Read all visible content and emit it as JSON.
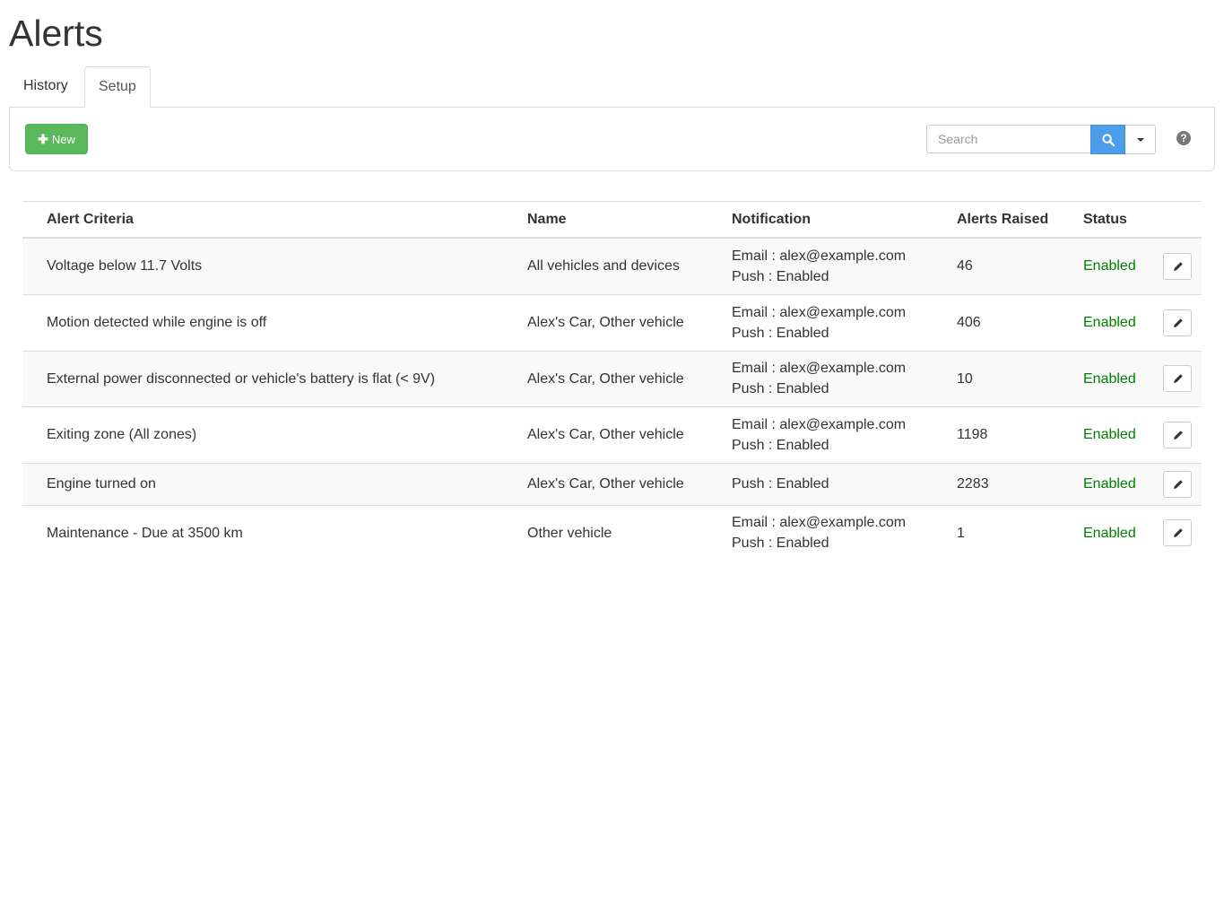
{
  "page": {
    "title": "Alerts"
  },
  "tabs": [
    {
      "label": "History",
      "active": false
    },
    {
      "label": "Setup",
      "active": true
    }
  ],
  "toolbar": {
    "new_label": "New",
    "search_placeholder": "Search",
    "help_icon": "question-circle-icon",
    "search_icon": "search-icon"
  },
  "colors": {
    "new_button": "#5cb85c",
    "search_button": "#4d9eea",
    "status_enabled": "#008000"
  },
  "table": {
    "headers": [
      "Alert Criteria",
      "Name",
      "Notification",
      "Alerts Raised",
      "Status"
    ],
    "rows": [
      {
        "criteria": "Voltage below 11.7 Volts",
        "name": "All vehicles and devices",
        "email": "Email : alex@example.com",
        "push": "Push : Enabled",
        "raised": "46",
        "status": "Enabled"
      },
      {
        "criteria": "Motion detected while engine is off",
        "name": "Alex's Car, Other vehicle",
        "email": "Email : alex@example.com",
        "push": "Push : Enabled",
        "raised": "406",
        "status": "Enabled"
      },
      {
        "criteria": "External power disconnected or vehicle's battery is flat (< 9V)",
        "name": "Alex's Car, Other vehicle",
        "email": "Email : alex@example.com",
        "push": "Push : Enabled",
        "raised": "10",
        "status": "Enabled"
      },
      {
        "criteria": "Exiting zone (All zones)",
        "name": "Alex's Car, Other vehicle",
        "email": "Email : alex@example.com",
        "push": "Push : Enabled",
        "raised": "1198",
        "status": "Enabled"
      },
      {
        "criteria": "Engine turned on",
        "name": "Alex's Car, Other vehicle",
        "email": "",
        "push": "Push : Enabled",
        "raised": "2283",
        "status": "Enabled"
      },
      {
        "criteria": "Maintenance - Due at 3500 km",
        "name": "Other vehicle",
        "email": "Email : alex@example.com",
        "push": "Push : Enabled",
        "raised": "1",
        "status": "Enabled"
      }
    ]
  }
}
